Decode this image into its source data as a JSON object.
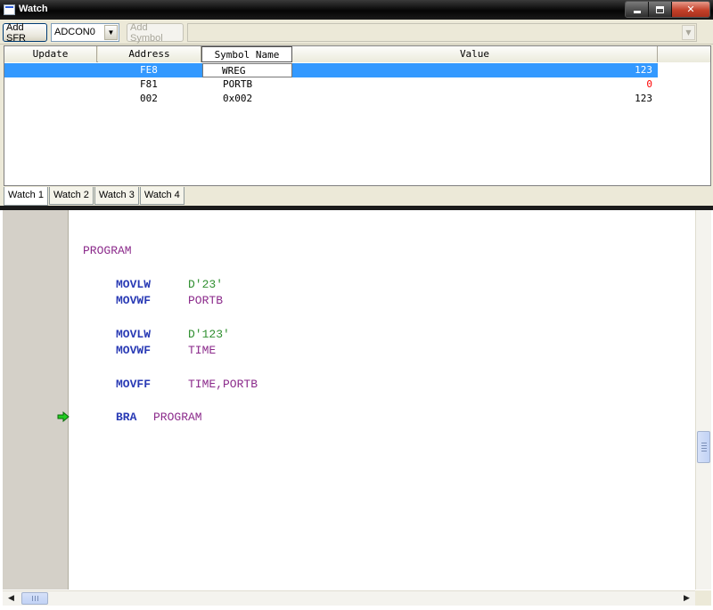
{
  "window": {
    "title": "Watch"
  },
  "toolbar": {
    "add_sfr_label": "Add SFR",
    "sfr_select_value": "ADCON0",
    "add_symbol_label": "Add Symbol"
  },
  "grid": {
    "headers": {
      "update": "Update",
      "address": "Address",
      "symbol": "Symbol Name",
      "value": "Value"
    },
    "rows": [
      {
        "address": "FE8",
        "symbol": "WREG",
        "value": "123",
        "selected": true
      },
      {
        "address": "F81",
        "symbol": "PORTB",
        "value": "0",
        "changed": true
      },
      {
        "address": "002",
        "symbol": "0x002",
        "value": "123"
      }
    ]
  },
  "tabs": [
    "Watch 1",
    "Watch 2",
    "Watch 3",
    "Watch 4"
  ],
  "active_tab": "Watch 1",
  "code": {
    "label_program": "PROGRAM",
    "lines": [
      {
        "op": "MOVLW",
        "arg": "D'23'",
        "arg_type": "num"
      },
      {
        "op": "MOVWF",
        "arg": "PORTB",
        "arg_type": "label"
      },
      {
        "op": "MOVLW",
        "arg": "D'123'",
        "arg_type": "num"
      },
      {
        "op": "MOVWF",
        "arg": "TIME",
        "arg_type": "label"
      },
      {
        "op": "MOVFF",
        "arg": "TIME,PORTB",
        "arg_type": "label"
      },
      {
        "op": "BRA",
        "arg": "PROGRAM",
        "arg_type": "label"
      }
    ],
    "execution_line": 6
  },
  "colors": {
    "selection": "#3399ff",
    "keyword": "#2a3bb5",
    "label": "#8b2a8b",
    "number": "#2f8f2f",
    "changed_value": "#ff0000",
    "exec_arrow": "#22cc22"
  }
}
